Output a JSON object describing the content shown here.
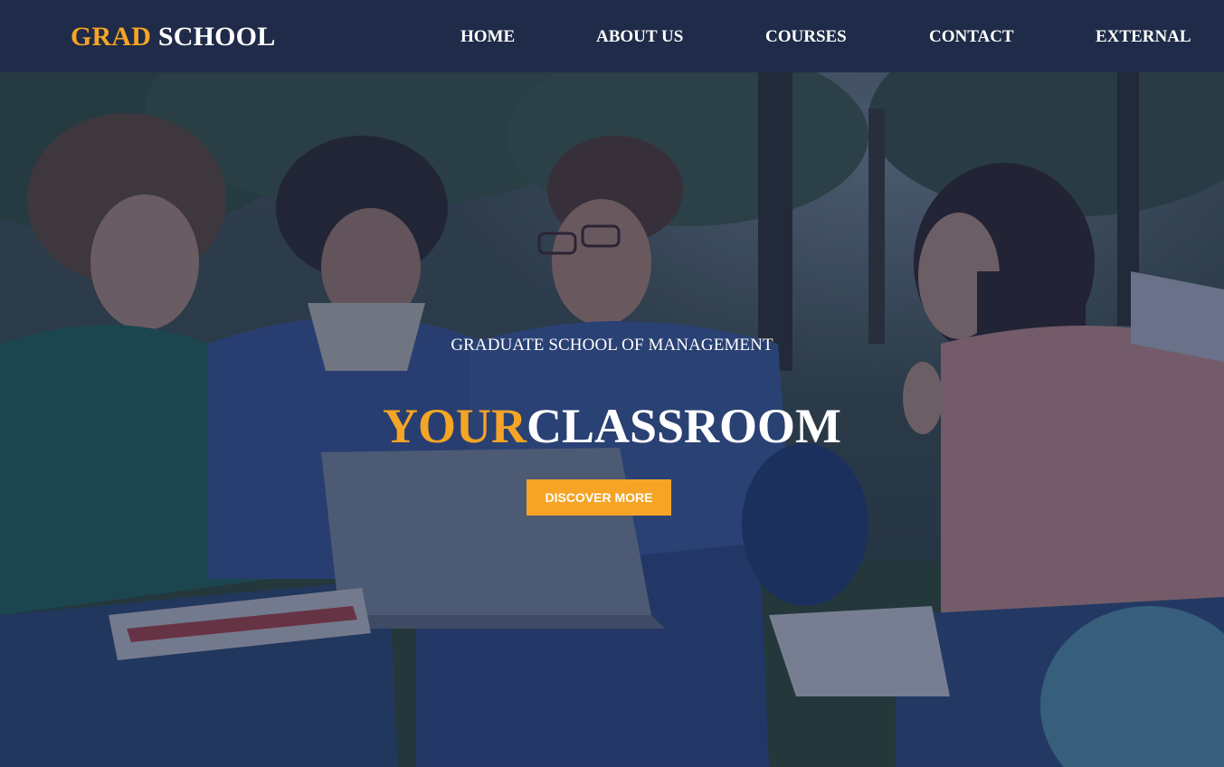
{
  "colors": {
    "header_bg": "#1f2b48",
    "accent": "#f5a425",
    "text": "#ffffff",
    "overlay": "rgba(28, 40, 72, 0.55)"
  },
  "header": {
    "logo_accent": "GRAD",
    "logo_rest": "SCHOOL"
  },
  "nav": {
    "items": [
      {
        "label": "HOME"
      },
      {
        "label": "ABOUT US"
      },
      {
        "label": "COURSES"
      },
      {
        "label": "CONTACT"
      },
      {
        "label": "EXTERNAL"
      }
    ]
  },
  "hero": {
    "subtitle": "GRADUATE SCHOOL OF MANAGEMENT",
    "title_accent": "YOUR",
    "title_rest": "CLASSROOM",
    "cta_label": "DISCOVER MORE"
  }
}
